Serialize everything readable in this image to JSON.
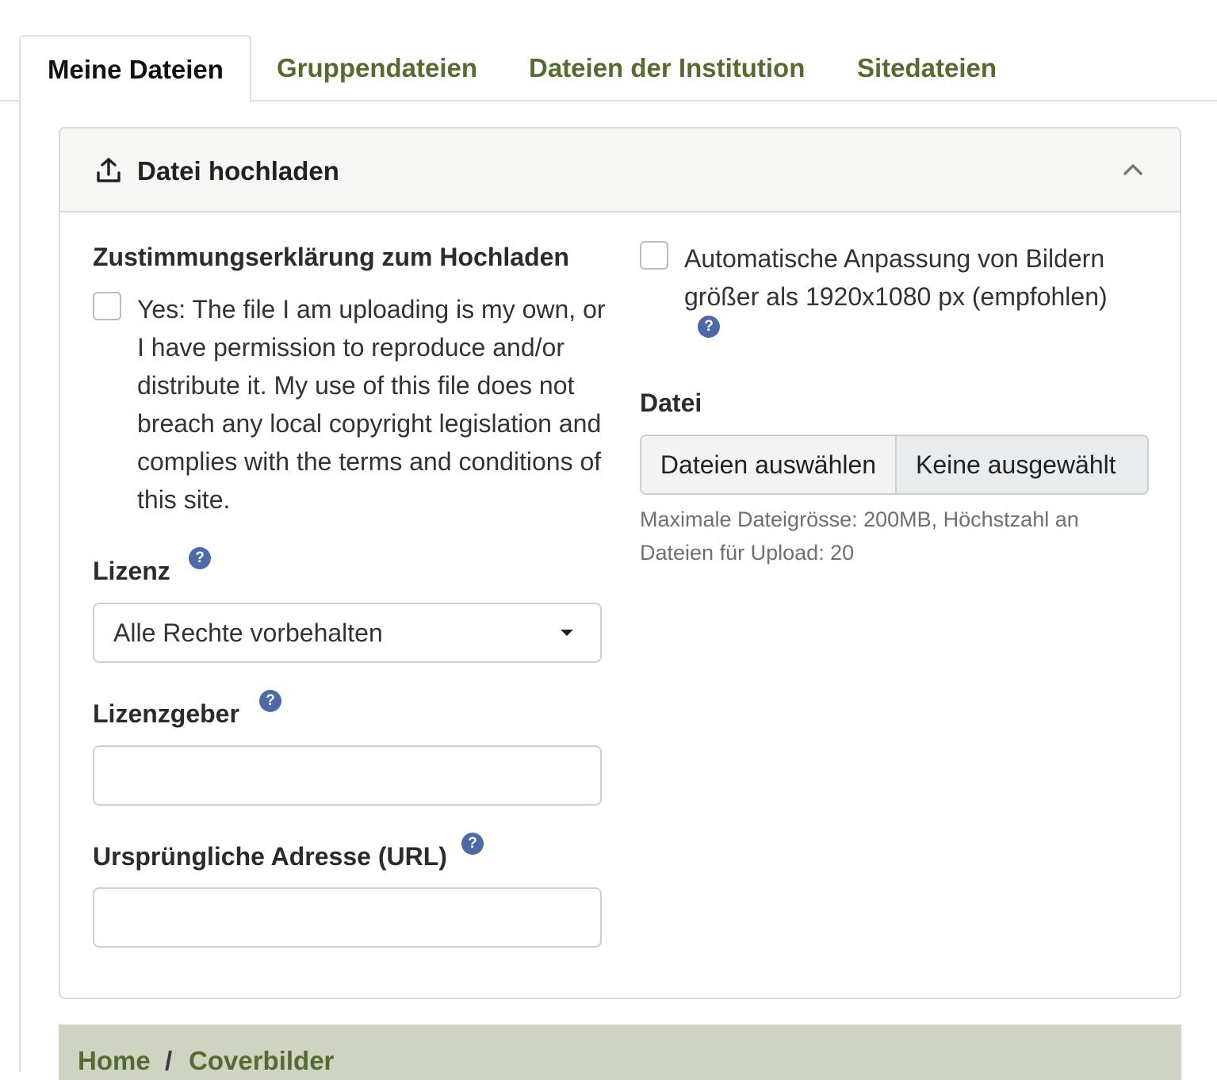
{
  "tabs": [
    {
      "label": "Meine Dateien",
      "active": true
    },
    {
      "label": "Gruppendateien",
      "active": false
    },
    {
      "label": "Dateien der Institution",
      "active": false
    },
    {
      "label": "Sitedateien",
      "active": false
    }
  ],
  "upload_panel": {
    "title": "Datei hochladen",
    "icon": "upload-icon",
    "collapse_icon": "chevron-up-icon"
  },
  "consent": {
    "heading": "Zustimmungserklärung zum Hochladen",
    "checkbox_label": "Yes: The file I am uploading is my own, or I have permission to reproduce and/or distribute it. My use of this file does not breach any local copyright legislation and complies with the terms and conditions of this site.",
    "checked": false
  },
  "license": {
    "label": "Lizenz",
    "help": "?",
    "selected": "Alle Rechte vorbehalten"
  },
  "licensor": {
    "label": "Lizenzgeber",
    "help": "?",
    "value": ""
  },
  "original_url": {
    "label": "Ursprüngliche Adresse (URL)",
    "help": "?",
    "value": ""
  },
  "resize": {
    "label": "Automatische Anpassung von Bildern größer als 1920x1080 px (empfohlen)",
    "help": "?",
    "checked": false
  },
  "file": {
    "label": "Datei",
    "button_label": "Dateien auswählen",
    "status": "Keine ausgewählt",
    "hint": "Maximale Dateigrösse: 200MB, Höchstzahl an Dateien für Upload: 20"
  },
  "breadcrumb": {
    "items": [
      "Home",
      "Coverbilder"
    ],
    "separator": "/"
  },
  "colors": {
    "link_green": "#566b2f",
    "help_blue": "#4d6aa7",
    "breadcrumb_bg": "#cfd3c2"
  }
}
